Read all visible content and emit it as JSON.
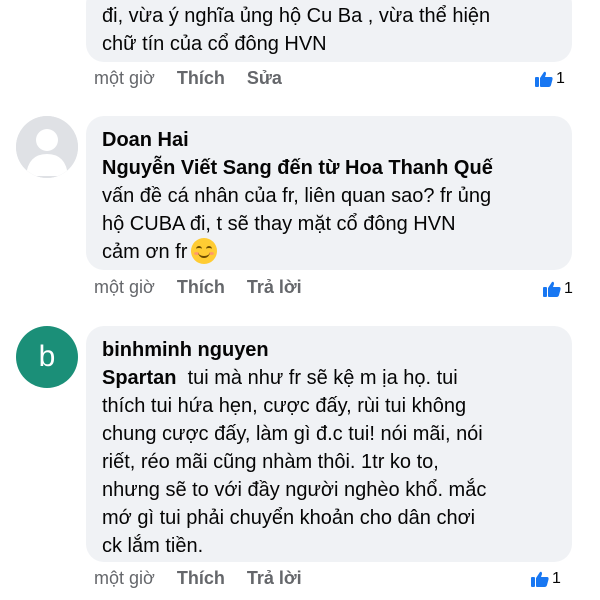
{
  "colors": {
    "bubble_bg": "#f0f2f5",
    "meta_text": "#65676b",
    "like_blue": "#1877f2",
    "avatar_green": "#1b8f78"
  },
  "comments": [
    {
      "text_lines": [
        "đi, vừa ý nghĩa ủng hộ Cu Ba , vừa thể hiện",
        "chữ tín của cổ đông HVN"
      ],
      "time": "một giờ",
      "actions": [
        "Thích",
        "Sửa"
      ],
      "like_count": "1"
    },
    {
      "author": "Doan Hai",
      "avatar": "default-avatar",
      "mention": "Nguyễn Viết Sang đến từ Hoa Thanh Quế",
      "text_lines": [
        "vấn đề cá nhân của fr, liên quan sao? fr ủng",
        "hộ CUBA đi, t sẽ thay mặt cổ đông HVN",
        "cảm ơn fr"
      ],
      "emoji": "smiling-face-icon",
      "time": "một giờ",
      "actions": [
        "Thích",
        "Trả lời"
      ],
      "like_count": "1"
    },
    {
      "author": "binhminh nguyen",
      "avatar_letter": "b",
      "mention": "Spartan",
      "text_lines": [
        "  tui mà như fr sẽ kệ m ịa họ. tui",
        "thích tui hứa hẹn, cược đấy, rùi tui không",
        "chung cược đấy, làm gì đ.c tui! nói mãi, nói",
        "riết, réo mãi cũng nhàm thôi. 1tr ko to,",
        "nhưng sẽ to với đầy người nghèo khổ. mắc",
        "mớ gì tui phải chuyển khoản cho dân chơi",
        "ck lắm tiền."
      ],
      "time": "một giờ",
      "actions": [
        "Thích",
        "Trả lời"
      ],
      "like_count": "1"
    }
  ]
}
